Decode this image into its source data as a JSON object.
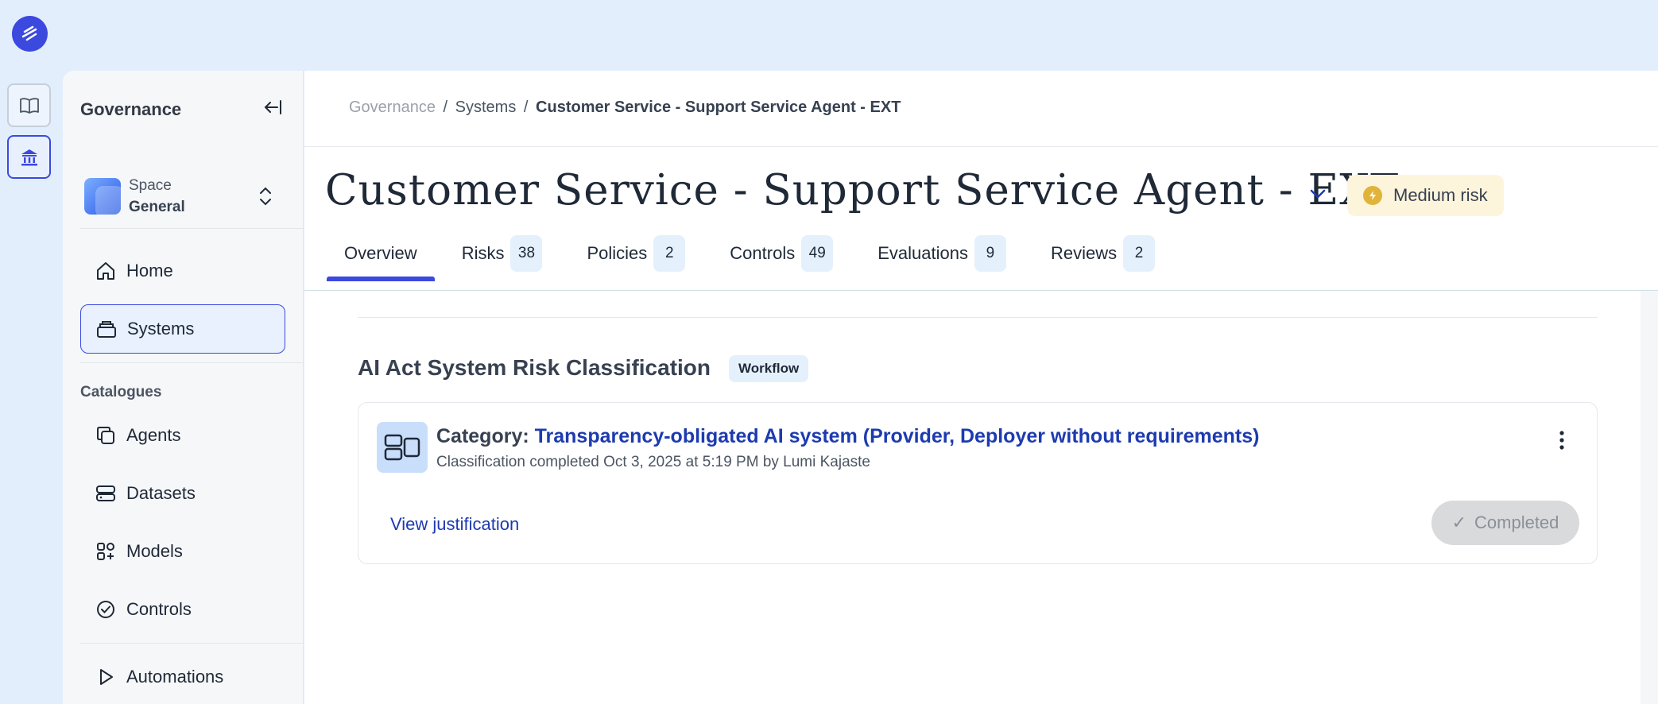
{
  "sidebar": {
    "title": "Governance",
    "space": {
      "label": "Space",
      "value": "General"
    },
    "nav": [
      {
        "label": "Home"
      },
      {
        "label": "Systems"
      }
    ],
    "catalogues_heading": "Catalogues",
    "catalogues": [
      {
        "label": "Agents"
      },
      {
        "label": "Datasets"
      },
      {
        "label": "Models"
      },
      {
        "label": "Controls"
      }
    ],
    "automations": {
      "label": "Automations"
    }
  },
  "breadcrumb": {
    "root": "Governance",
    "sep": "/",
    "middle": "Systems",
    "current": "Customer Service - Support Service Agent - EXT"
  },
  "page": {
    "title": "Customer Service - Support Service Agent - EXT",
    "risk_label": "Medium risk"
  },
  "tabs": [
    {
      "label": "Overview"
    },
    {
      "label": "Risks",
      "count": "38"
    },
    {
      "label": "Policies",
      "count": "2"
    },
    {
      "label": "Controls",
      "count": "49"
    },
    {
      "label": "Evaluations",
      "count": "9"
    },
    {
      "label": "Reviews",
      "count": "2"
    }
  ],
  "section": {
    "title": "AI Act System Risk Classification",
    "chip": "Workflow"
  },
  "card": {
    "label": "Category:",
    "value": "Transparency-obligated AI system (Provider, Deployer without requirements)",
    "subtitle": "Classification completed Oct 3, 2025 at 5:19 PM by Lumi Kajaste",
    "link": "View justification",
    "status_check": "✓",
    "status": "Completed"
  },
  "colors": {
    "accent": "#3b49df",
    "link": "#1d3bb0",
    "risk_badge_bg": "#fdf4dc",
    "chip_bg": "#e5f0fd"
  }
}
